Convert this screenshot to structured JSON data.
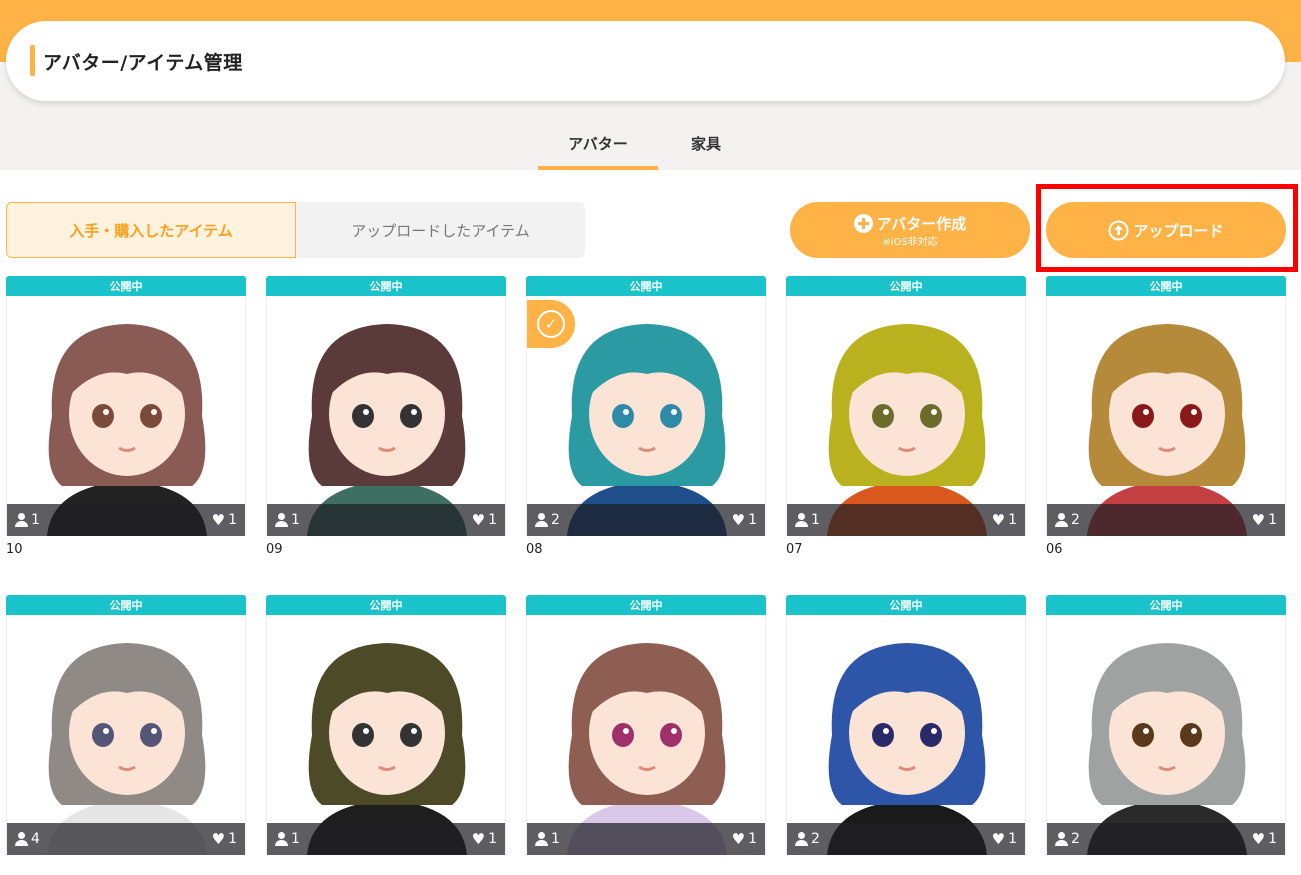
{
  "header": {
    "title": "アバター/アイテム管理"
  },
  "main_tabs": [
    {
      "label": "アバター",
      "active": true
    },
    {
      "label": "家具",
      "active": false
    }
  ],
  "subtabs": [
    {
      "label": "入手・購入したアイテム",
      "active": true
    },
    {
      "label": "アップロードしたアイテム",
      "active": false
    }
  ],
  "actions": {
    "create_avatar": {
      "label": "アバター作成",
      "note": "※iOS非対応"
    },
    "upload": {
      "label": "アップロード"
    }
  },
  "colors": {
    "accent": "#ffb347",
    "status": "#19c3c9",
    "highlight": "#ff0000"
  },
  "avatars": [
    {
      "name": "10",
      "status": "公開中",
      "users": "1",
      "likes": "1",
      "selected": false,
      "hair": "#8a5a55",
      "shirt": "#222222",
      "eyes": "#7a4a3a"
    },
    {
      "name": "09",
      "status": "公開中",
      "users": "1",
      "likes": "1",
      "selected": false,
      "hair": "#5b3a3a",
      "shirt": "#3e6f60",
      "eyes": "#333333"
    },
    {
      "name": "08",
      "status": "公開中",
      "users": "2",
      "likes": "1",
      "selected": true,
      "hair": "#2b9aa2",
      "shirt": "#1f4f8a",
      "eyes": "#2e8aa8"
    },
    {
      "name": "07",
      "status": "公開中",
      "users": "1",
      "likes": "1",
      "selected": false,
      "hair": "#b9b21e",
      "shirt": "#d9581e",
      "eyes": "#6b6b2a"
    },
    {
      "name": "06",
      "status": "公開中",
      "users": "2",
      "likes": "1",
      "selected": false,
      "hair": "#b58a3a",
      "shirt": "#c44040",
      "eyes": "#8a1a1a"
    },
    {
      "name": "",
      "status": "公開中",
      "users": "4",
      "likes": "1",
      "selected": false,
      "hair": "#8f8a86",
      "shirt": "#e6e6e6",
      "eyes": "#555577"
    },
    {
      "name": "",
      "status": "公開中",
      "users": "1",
      "likes": "1",
      "selected": false,
      "hair": "#4d4a28",
      "shirt": "#1e1e1e",
      "eyes": "#333333"
    },
    {
      "name": "",
      "status": "公開中",
      "users": "1",
      "likes": "1",
      "selected": false,
      "hair": "#8e5e52",
      "shirt": "#d9c8e8",
      "eyes": "#a0306a"
    },
    {
      "name": "",
      "status": "公開中",
      "users": "2",
      "likes": "1",
      "selected": false,
      "hair": "#2d55a8",
      "shirt": "#1a1a1a",
      "eyes": "#2a2a6a"
    },
    {
      "name": "",
      "status": "公開中",
      "users": "2",
      "likes": "1",
      "selected": false,
      "hair": "#9ea3a2",
      "shirt": "#2a2a2a",
      "eyes": "#5a3a1a"
    }
  ]
}
